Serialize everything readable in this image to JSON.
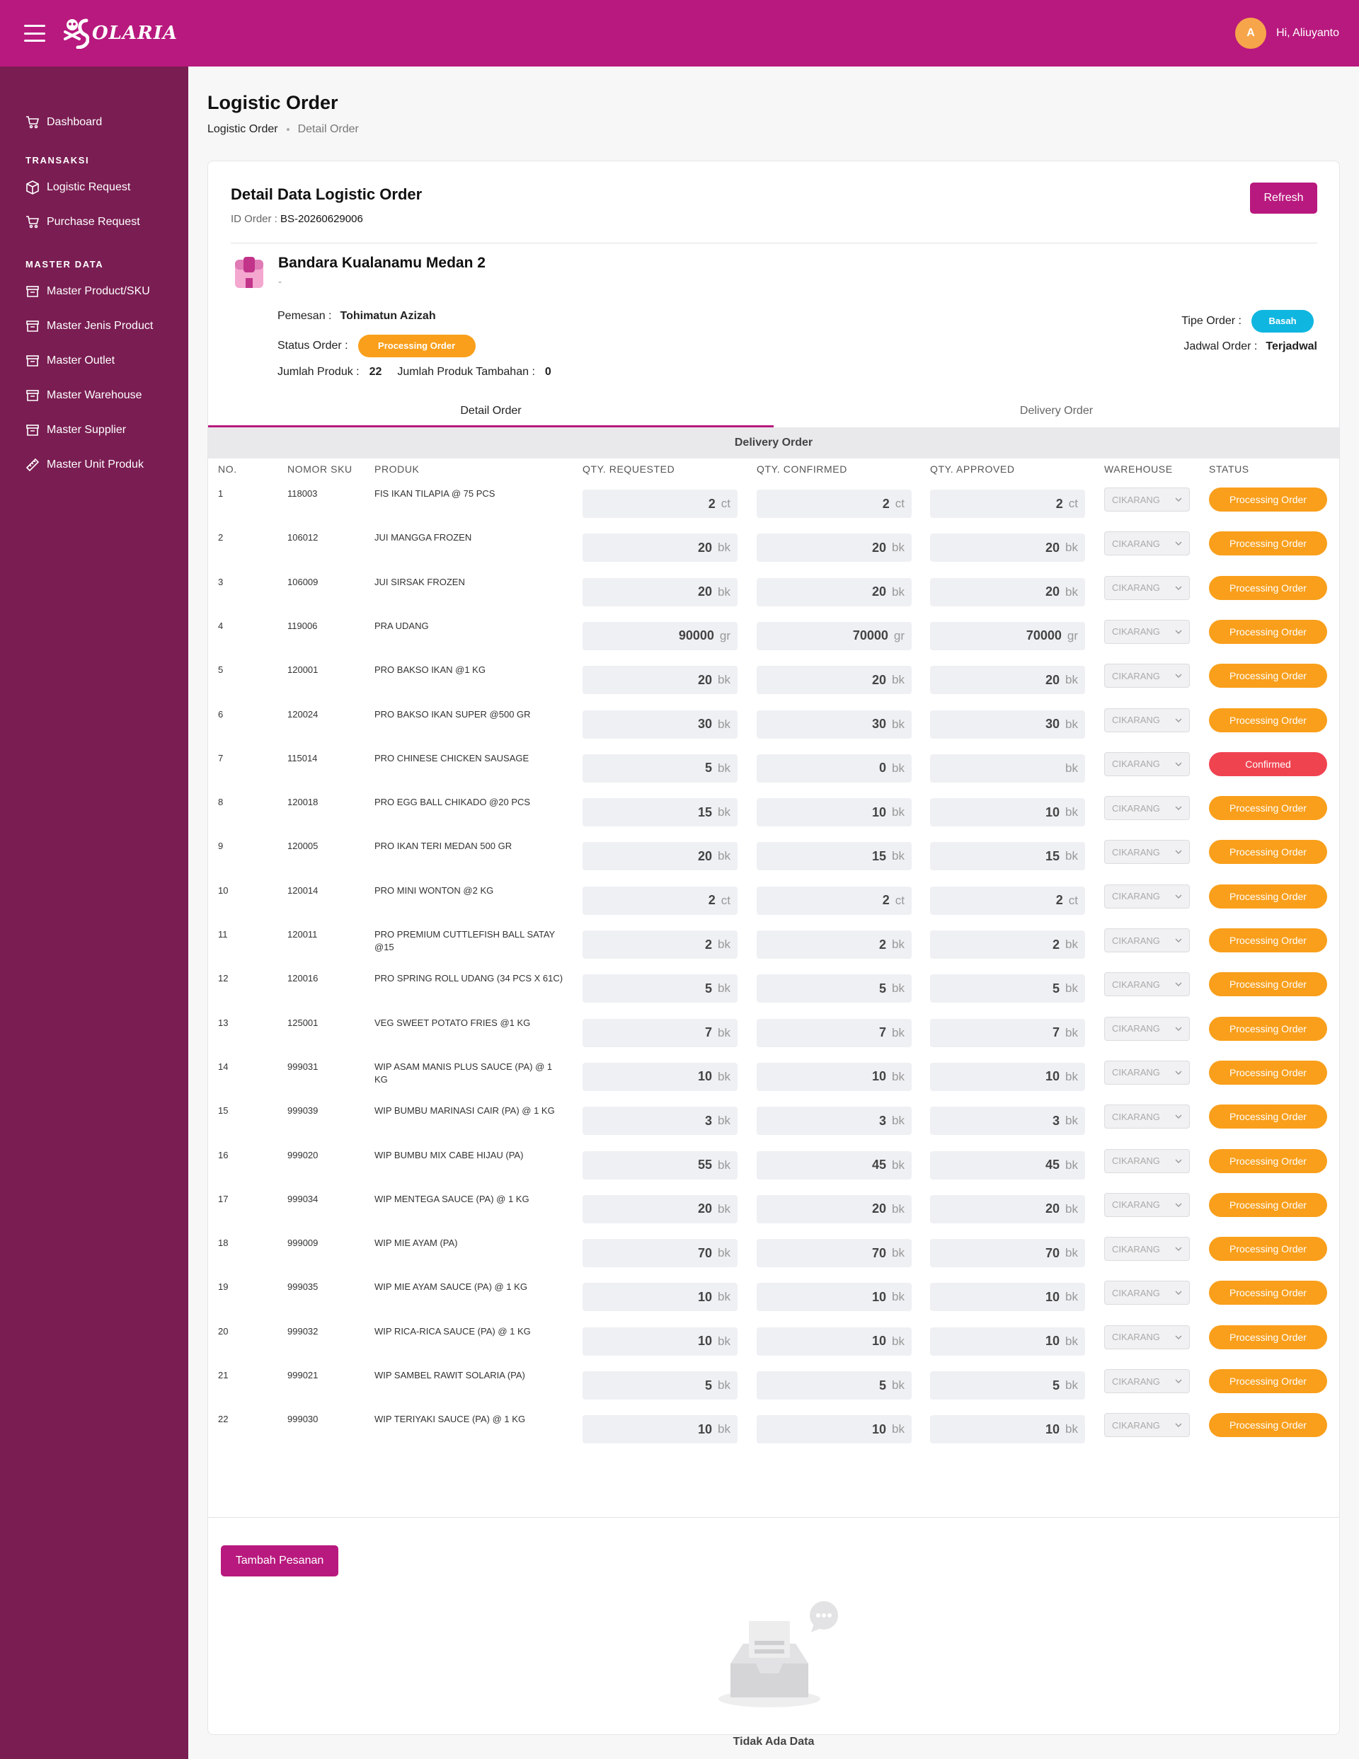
{
  "app": {
    "brand": "OLARIA",
    "greeting": "Hi, Aliuyanto",
    "avatar_initial": "A",
    "accent": "#b8197e",
    "sidebar_bg": "#7a1d52"
  },
  "sidebar": {
    "dashboard": "Dashboard",
    "section_transaksi": "TRANSAKSI",
    "logistic_request": "Logistic Request",
    "purchase_request": "Purchase Request",
    "section_master": "MASTER DATA",
    "master_product": "Master Product/SKU",
    "master_jenis": "Master Jenis Product",
    "master_outlet": "Master Outlet",
    "master_warehouse": "Master Warehouse",
    "master_supplier": "Master Supplier",
    "master_unit": "Master Unit Produk"
  },
  "page": {
    "title": "Logistic Order",
    "breadcrumb_1": "Logistic Order",
    "breadcrumb_2": "Detail Order"
  },
  "card": {
    "title": "Detail Data Logistic Order",
    "id_label": "ID Order :",
    "id_value": "BS-20260629006",
    "refresh": "Refresh",
    "store_name": "Bandara Kualanamu Medan 2",
    "store_sub": "-",
    "pemesan_label": "Pemesan :",
    "pemesan_value": "Tohimatun Azizah",
    "status_label": "Status Order :",
    "status_value": "Processing Order",
    "jumlah_label": "Jumlah Produk :",
    "jumlah_value": "22",
    "tambahan_label": "Jumlah Produk Tambahan :",
    "tambahan_value": "0",
    "tipe_label": "Tipe Order :",
    "tipe_value": "Basah",
    "jadwal_label": "Jadwal Order :",
    "jadwal_value": "Terjadwal"
  },
  "tabs": [
    "Detail Order",
    "Delivery Order"
  ],
  "delivery_header": "Delivery Order",
  "columns": [
    "NO.",
    "NOMOR SKU",
    "PRODUK",
    "QTY. REQUESTED",
    "QTY. CONFIRMED",
    "QTY. APPROVED",
    "WAREHOUSE",
    "STATUS"
  ],
  "rows": [
    {
      "no": "1",
      "sku": "118003",
      "produk": "FIS IKAN TILAPIA @ 75 PCS",
      "req": "2",
      "conf": "2",
      "appr": "2",
      "unit": "ct",
      "wh": "CIKARANG",
      "status": "Processing Order"
    },
    {
      "no": "2",
      "sku": "106012",
      "produk": "JUI MANGGA FROZEN",
      "req": "20",
      "conf": "20",
      "appr": "20",
      "unit": "bk",
      "wh": "CIKARANG",
      "status": "Processing Order"
    },
    {
      "no": "3",
      "sku": "106009",
      "produk": "JUI SIRSAK FROZEN",
      "req": "20",
      "conf": "20",
      "appr": "20",
      "unit": "bk",
      "wh": "CIKARANG",
      "status": "Processing Order"
    },
    {
      "no": "4",
      "sku": "119006",
      "produk": "PRA UDANG",
      "req": "90000",
      "conf": "70000",
      "appr": "70000",
      "unit": "gr",
      "wh": "CIKARANG",
      "status": "Processing Order"
    },
    {
      "no": "5",
      "sku": "120001",
      "produk": "PRO BAKSO IKAN @1 KG",
      "req": "20",
      "conf": "20",
      "appr": "20",
      "unit": "bk",
      "wh": "CIKARANG",
      "status": "Processing Order"
    },
    {
      "no": "6",
      "sku": "120024",
      "produk": "PRO BAKSO IKAN SUPER @500 GR",
      "req": "30",
      "conf": "30",
      "appr": "30",
      "unit": "bk",
      "wh": "CIKARANG",
      "status": "Processing Order"
    },
    {
      "no": "7",
      "sku": "115014",
      "produk": "PRO CHINESE CHICKEN SAUSAGE",
      "req": "5",
      "conf": "0",
      "appr": "",
      "unit": "bk",
      "wh": "CIKARANG",
      "status": "Confirmed"
    },
    {
      "no": "8",
      "sku": "120018",
      "produk": "PRO EGG BALL CHIKADO @20 PCS",
      "req": "15",
      "conf": "10",
      "appr": "10",
      "unit": "bk",
      "wh": "CIKARANG",
      "status": "Processing Order"
    },
    {
      "no": "9",
      "sku": "120005",
      "produk": "PRO IKAN TERI MEDAN 500 GR",
      "req": "20",
      "conf": "15",
      "appr": "15",
      "unit": "bk",
      "wh": "CIKARANG",
      "status": "Processing Order"
    },
    {
      "no": "10",
      "sku": "120014",
      "produk": "PRO MINI WONTON @2 KG",
      "req": "2",
      "conf": "2",
      "appr": "2",
      "unit": "ct",
      "wh": "CIKARANG",
      "status": "Processing Order"
    },
    {
      "no": "11",
      "sku": "120011",
      "produk": "PRO PREMIUM CUTTLEFISH BALL SATAY @15",
      "req": "2",
      "conf": "2",
      "appr": "2",
      "unit": "bk",
      "wh": "CIKARANG",
      "status": "Processing Order"
    },
    {
      "no": "12",
      "sku": "120016",
      "produk": "PRO SPRING ROLL UDANG (34 PCS X 61C)",
      "req": "5",
      "conf": "5",
      "appr": "5",
      "unit": "bk",
      "wh": "CIKARANG",
      "status": "Processing Order"
    },
    {
      "no": "13",
      "sku": "125001",
      "produk": "VEG SWEET POTATO FRIES @1 KG",
      "req": "7",
      "conf": "7",
      "appr": "7",
      "unit": "bk",
      "wh": "CIKARANG",
      "status": "Processing Order"
    },
    {
      "no": "14",
      "sku": "999031",
      "produk": "WIP ASAM MANIS PLUS SAUCE (PA) @ 1 KG",
      "req": "10",
      "conf": "10",
      "appr": "10",
      "unit": "bk",
      "wh": "CIKARANG",
      "status": "Processing Order"
    },
    {
      "no": "15",
      "sku": "999039",
      "produk": "WIP BUMBU MARINASI CAIR (PA) @ 1 KG",
      "req": "3",
      "conf": "3",
      "appr": "3",
      "unit": "bk",
      "wh": "CIKARANG",
      "status": "Processing Order"
    },
    {
      "no": "16",
      "sku": "999020",
      "produk": "WIP BUMBU MIX CABE HIJAU (PA)",
      "req": "55",
      "conf": "45",
      "appr": "45",
      "unit": "bk",
      "wh": "CIKARANG",
      "status": "Processing Order"
    },
    {
      "no": "17",
      "sku": "999034",
      "produk": "WIP MENTEGA SAUCE (PA) @ 1 KG",
      "req": "20",
      "conf": "20",
      "appr": "20",
      "unit": "bk",
      "wh": "CIKARANG",
      "status": "Processing Order"
    },
    {
      "no": "18",
      "sku": "999009",
      "produk": "WIP MIE AYAM (PA)",
      "req": "70",
      "conf": "70",
      "appr": "70",
      "unit": "bk",
      "wh": "CIKARANG",
      "status": "Processing Order"
    },
    {
      "no": "19",
      "sku": "999035",
      "produk": "WIP MIE AYAM SAUCE (PA) @ 1 KG",
      "req": "10",
      "conf": "10",
      "appr": "10",
      "unit": "bk",
      "wh": "CIKARANG",
      "status": "Processing Order"
    },
    {
      "no": "20",
      "sku": "999032",
      "produk": "WIP RICA-RICA SAUCE (PA) @ 1 KG",
      "req": "10",
      "conf": "10",
      "appr": "10",
      "unit": "bk",
      "wh": "CIKARANG",
      "status": "Processing Order"
    },
    {
      "no": "21",
      "sku": "999021",
      "produk": "WIP SAMBEL RAWIT SOLARIA (PA)",
      "req": "5",
      "conf": "5",
      "appr": "5",
      "unit": "bk",
      "wh": "CIKARANG",
      "status": "Processing Order"
    },
    {
      "no": "22",
      "sku": "999030",
      "produk": "WIP TERIYAKI SAUCE (PA) @ 1 KG",
      "req": "10",
      "conf": "10",
      "appr": "10",
      "unit": "bk",
      "wh": "CIKARANG",
      "status": "Processing Order"
    }
  ],
  "tambah_button": "Tambah Pesanan",
  "empty_text": "Tidak Ada Data",
  "icons": {
    "menu": "hamburger-icon",
    "cart": "cart-icon",
    "box": "box-icon",
    "archive": "archive-icon",
    "ruler": "ruler-icon",
    "store": "store-icon",
    "chevron": "chevron-down-icon"
  }
}
